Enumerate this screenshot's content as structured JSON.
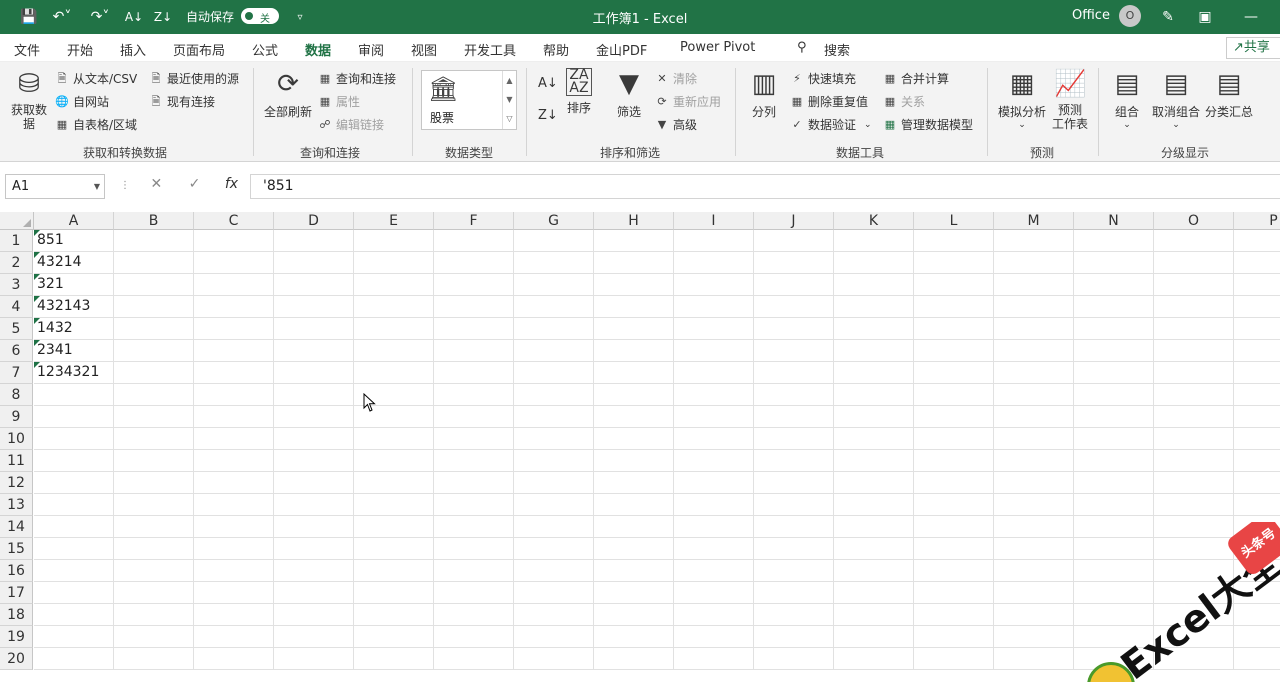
{
  "titlebar": {
    "autosave_label": "自动保存",
    "autosave_state": "关",
    "doc_title": "工作簿1  -  Excel",
    "office_label": "Office",
    "avatar_initial": "O"
  },
  "menu": {
    "tabs": [
      "文件",
      "开始",
      "插入",
      "页面布局",
      "公式",
      "数据",
      "审阅",
      "视图",
      "开发工具",
      "帮助",
      "金山PDF",
      "Power Pivot"
    ],
    "active_tab": "数据",
    "search_label": "搜索",
    "share_label": "共享"
  },
  "ribbon": {
    "get_data": "获取数\n据",
    "from_text": "从文本/CSV",
    "from_web": "自网站",
    "from_table": "自表格/区域",
    "recent_sources": "最近使用的源",
    "existing_conn": "现有连接",
    "group_get": "获取和转换数据",
    "refresh_all": "全部刷新",
    "queries_conn": "查询和连接",
    "properties": "属性",
    "edit_links": "编辑链接",
    "group_queries": "查询和连接",
    "stocks": "股票",
    "group_datatypes": "数据类型",
    "sort": "排序",
    "filter": "筛选",
    "clear": "清除",
    "reapply": "重新应用",
    "advanced": "高级",
    "group_sort": "排序和筛选",
    "text_to_cols": "分列",
    "flash_fill": "快速填充",
    "remove_dup": "删除重复值",
    "data_validation": "数据验证",
    "consolidate": "合并计算",
    "relationships": "关系",
    "manage_model": "管理数据模型",
    "group_tools": "数据工具",
    "what_if": "模拟分析",
    "forecast_sheet": "预测\n工作表",
    "group_forecast": "预测",
    "group": "组合",
    "ungroup": "取消组合",
    "subtotal": "分类汇总",
    "group_outline": "分级显示"
  },
  "formula_bar": {
    "name_box": "A1",
    "formula": "'851"
  },
  "grid": {
    "columns": [
      "A",
      "B",
      "C",
      "D",
      "E",
      "F",
      "G",
      "H",
      "I",
      "J",
      "K",
      "L",
      "M",
      "N",
      "O",
      "P"
    ],
    "rows": [
      "1",
      "2",
      "3",
      "4",
      "5",
      "6",
      "7",
      "8",
      "9",
      "10",
      "11",
      "12",
      "13",
      "14",
      "15",
      "16",
      "17",
      "18",
      "19",
      "20"
    ],
    "cells_A": [
      "851",
      "43214",
      "321",
      "432143",
      "1432",
      "2341",
      "1234321"
    ]
  },
  "watermark": {
    "text": "Excel大全",
    "badge": "头条号"
  },
  "colors": {
    "brand": "#217346",
    "indicator": "#1e7145"
  }
}
